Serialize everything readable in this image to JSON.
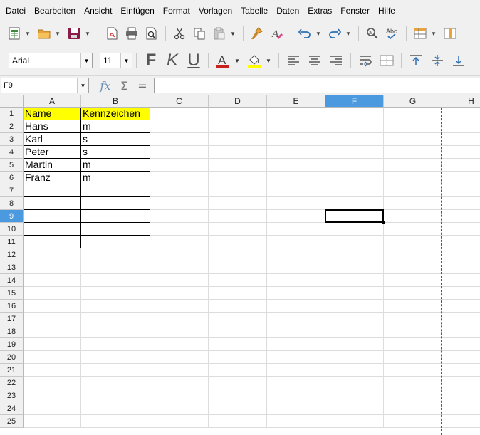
{
  "menu": [
    "Datei",
    "Bearbeiten",
    "Ansicht",
    "Einfügen",
    "Format",
    "Vorlagen",
    "Tabelle",
    "Daten",
    "Extras",
    "Fenster",
    "Hilfe"
  ],
  "format_toolbar": {
    "font_name": "Arial",
    "font_size": "11",
    "bold_label": "F",
    "italic_label": "K",
    "underline_label": "U",
    "font_color": "#c9211e",
    "highlight_color": "#ffff00"
  },
  "formula_bar": {
    "cell_reference": "F9",
    "fx_label": "fx",
    "sum_label": "Σ",
    "equals_label": "=",
    "content": ""
  },
  "sheet": {
    "columns": [
      "A",
      "B",
      "C",
      "D",
      "E",
      "F",
      "G",
      "H"
    ],
    "rows": [
      "1",
      "2",
      "3",
      "4",
      "5",
      "6",
      "7",
      "8",
      "9",
      "10",
      "11",
      "12",
      "13",
      "14",
      "15",
      "16",
      "17",
      "18",
      "19",
      "20",
      "21",
      "22",
      "23",
      "24",
      "25"
    ],
    "selected_column": "F",
    "selected_row": "9",
    "header_row": [
      "Name",
      "Kennzeichen"
    ],
    "data_rows": [
      [
        "Hans",
        "m"
      ],
      [
        "Karl",
        "s"
      ],
      [
        "Peter",
        "s"
      ],
      [
        "Martin",
        "m"
      ],
      [
        "Franz",
        "m"
      ]
    ],
    "header_fill": "#ffff00",
    "accent": "#4b9ae0"
  }
}
